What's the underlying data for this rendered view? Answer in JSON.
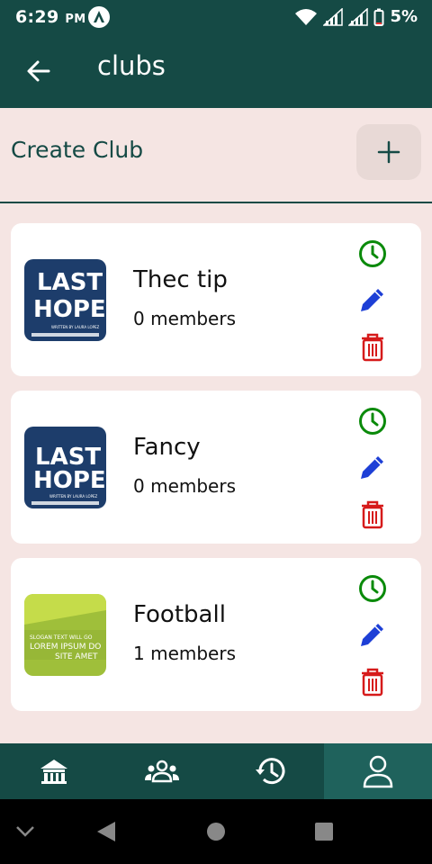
{
  "status_bar": {
    "time": "6:29",
    "ampm": "PM",
    "battery": "5%"
  },
  "appbar": {
    "title": "clubs"
  },
  "create": {
    "label": "Create Club"
  },
  "clubs": [
    {
      "name": "Thec tip",
      "members": "0 members",
      "thumb": {
        "line1": "LAST",
        "line2": "HOPE",
        "caption": "WRITTEN BY LAURA LOPEZ",
        "bg": "#1d3d6b"
      }
    },
    {
      "name": "Fancy",
      "members": "0 members",
      "thumb": {
        "line1": "LAST",
        "line2": "HOPE",
        "caption": "WRITTEN BY LAURA LOPEZ",
        "bg": "#1d3d6b"
      }
    },
    {
      "name": "Football",
      "members": "1 members",
      "thumb": {
        "line1": "SLOGAN TEXT WILL GO",
        "line2": "LOREM IPSUM DO",
        "line3": "SITE AMET",
        "bg": "#9fbf3a"
      }
    }
  ],
  "colors": {
    "primary": "#154a45",
    "accent_active": "#1f625c",
    "bg": "#f5e5e3",
    "clock": "#0a8a0a",
    "edit": "#1d3fd6",
    "trash": "#d61a1a"
  },
  "bottom_nav": [
    "home-icon",
    "groups-icon",
    "history-icon",
    "person-icon"
  ]
}
